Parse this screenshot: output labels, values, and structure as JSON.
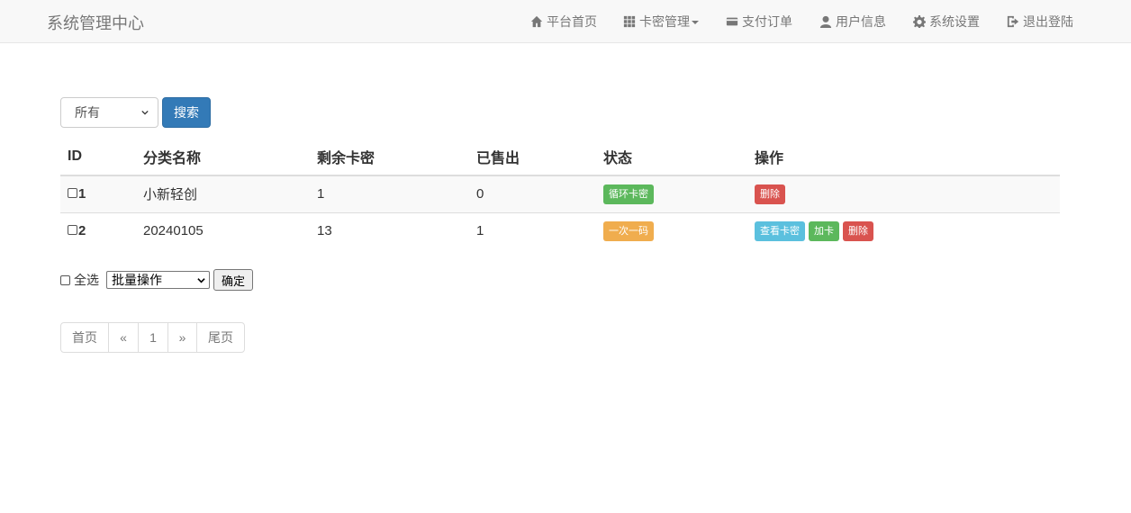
{
  "brand": "系统管理中心",
  "nav": [
    {
      "label": "平台首页",
      "icon": "home-icon"
    },
    {
      "label": "卡密管理",
      "icon": "grid-icon",
      "dropdown": true
    },
    {
      "label": "支付订单",
      "icon": "credit-card-icon"
    },
    {
      "label": "用户信息",
      "icon": "user-icon"
    },
    {
      "label": "系统设置",
      "icon": "gear-icon"
    },
    {
      "label": "退出登陆",
      "icon": "logout-icon"
    }
  ],
  "filter": {
    "selected": "所有",
    "search_label": "搜索"
  },
  "table": {
    "headers": [
      "ID",
      "分类名称",
      "剩余卡密",
      "已售出",
      "状态",
      "操作"
    ],
    "rows": [
      {
        "id": "1",
        "name": "小新轻创",
        "remaining": "1",
        "sold": "0",
        "status": "循环卡密",
        "status_color": "#5cb85c",
        "actions": [
          {
            "label": "删除",
            "color": "#d9534f"
          }
        ]
      },
      {
        "id": "2",
        "name": "20240105",
        "remaining": "13",
        "sold": "1",
        "status": "一次一码",
        "status_color": "#f0ad4e",
        "actions": [
          {
            "label": "查看卡密",
            "color": "#5bc0de"
          },
          {
            "label": "加卡",
            "color": "#5cb85c"
          },
          {
            "label": "删除",
            "color": "#d9534f"
          }
        ]
      }
    ]
  },
  "batch": {
    "select_all": "全选",
    "operation": "批量操作",
    "confirm": "确定"
  },
  "pager": [
    "首页",
    "«",
    "1",
    "»",
    "尾页"
  ]
}
